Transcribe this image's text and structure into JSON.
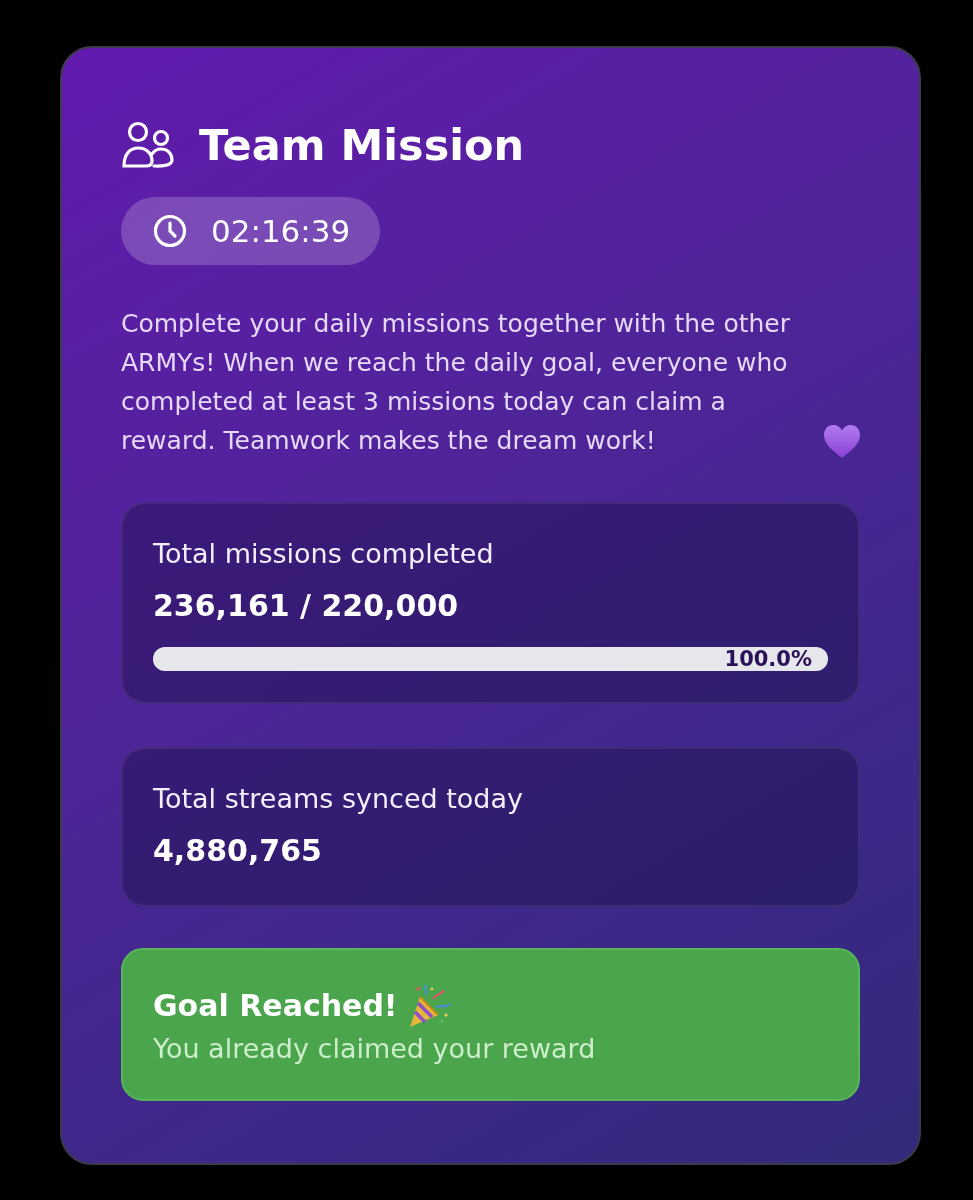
{
  "header": {
    "title": "Team Mission",
    "timer": "02:16:39"
  },
  "description": "Complete your daily missions together with the other ARMYs! When we reach the daily goal, everyone who completed at least 3 missions today can claim a reward. Teamwork makes the dream work!",
  "stats": [
    {
      "kind": "progress",
      "label": "Total missions completed",
      "value": "236,161 / 220,000",
      "level": 1.0,
      "reading": "100.0%"
    },
    {
      "kind": "plain",
      "label": "Total streams synced today",
      "value": "4,880,765"
    }
  ],
  "goal_banner": {
    "title": "Goal Reached!",
    "message": "You already claimed your reward"
  }
}
